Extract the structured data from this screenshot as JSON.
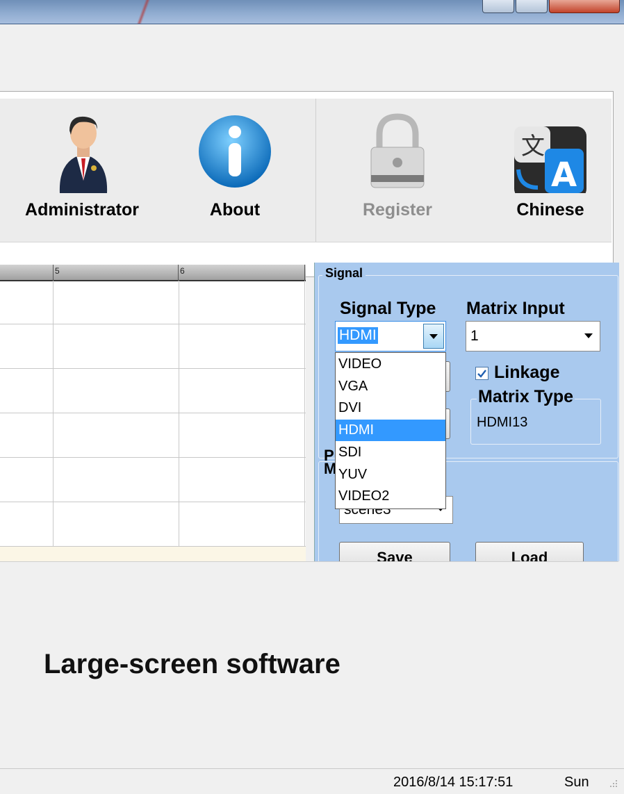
{
  "toolbar": {
    "administrator_label": "Administrator",
    "about_label": "About",
    "register_label": "Register",
    "chinese_label": "Chinese"
  },
  "grid": {
    "columns": [
      "5",
      "6"
    ]
  },
  "signal_panel": {
    "group_title": "Signal",
    "signal_type_label": "Signal Type",
    "signal_type_value": "HDMI",
    "matrix_input_label": "Matrix Input",
    "matrix_input_value": "1",
    "linkage_label": "Linkage",
    "linkage_checked": true,
    "matrix_type_title": "Matrix Type",
    "matrix_type_value": "HDMI13",
    "preset_partial_label": "P",
    "preset_partial_label2": "M",
    "scene_value": "scene3",
    "save_label": "Save",
    "load_label": "Load"
  },
  "dropdown": {
    "options": [
      "VIDEO",
      "VGA",
      "DVI",
      "HDMI",
      "SDI",
      "YUV",
      "VIDEO2"
    ],
    "selected": "HDMI"
  },
  "main_text": "Large-screen software",
  "status": {
    "datetime": "2016/8/14 15:17:51",
    "weekday": "Sun"
  }
}
